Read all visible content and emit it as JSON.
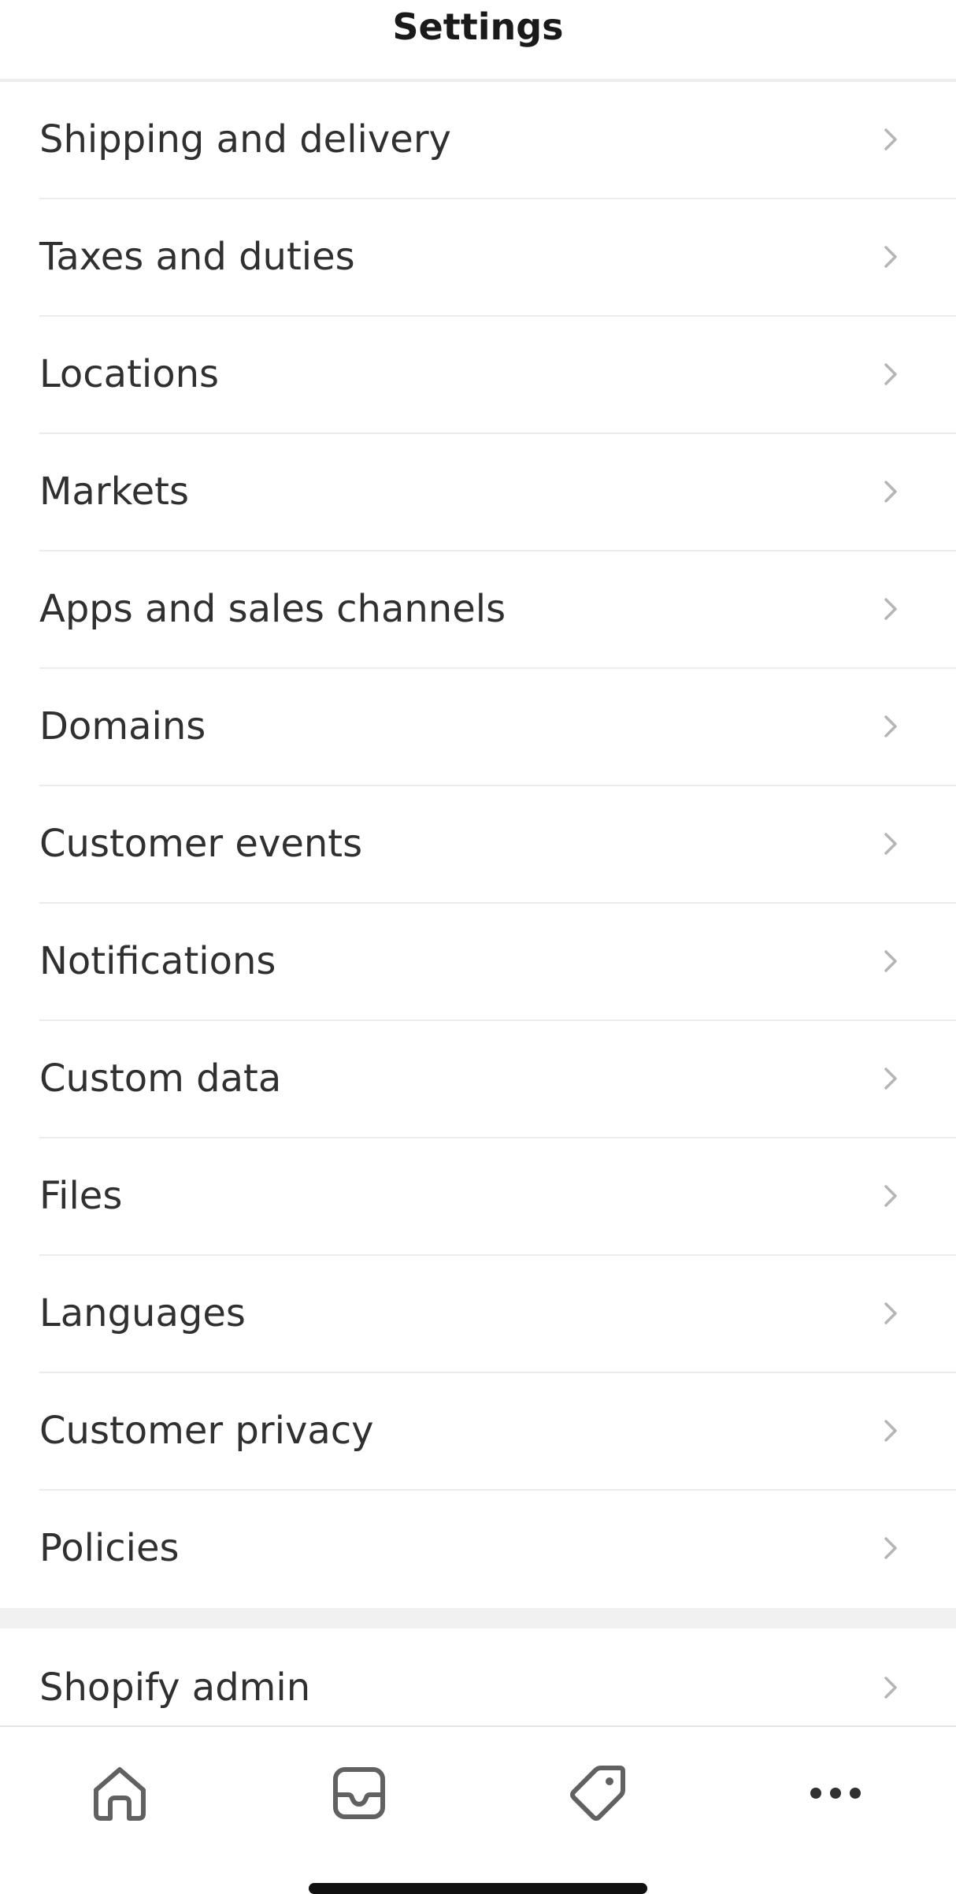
{
  "header": {
    "title": "Settings"
  },
  "settings_items": [
    {
      "label": "Shipping and delivery"
    },
    {
      "label": "Taxes and duties"
    },
    {
      "label": "Locations"
    },
    {
      "label": "Markets"
    },
    {
      "label": "Apps and sales channels"
    },
    {
      "label": "Domains"
    },
    {
      "label": "Customer events"
    },
    {
      "label": "Notifications"
    },
    {
      "label": "Custom data"
    },
    {
      "label": "Files"
    },
    {
      "label": "Languages"
    },
    {
      "label": "Customer privacy"
    },
    {
      "label": "Policies"
    }
  ],
  "secondary_items": [
    {
      "label": "Shopify admin"
    }
  ],
  "tabbar": {
    "tabs": [
      {
        "icon": "home-icon"
      },
      {
        "icon": "inbox-icon"
      },
      {
        "icon": "tag-icon"
      },
      {
        "icon": "more-icon"
      }
    ]
  },
  "colors": {
    "text": "#303030",
    "chevron": "#b5b5b5",
    "divider": "#ececec",
    "section_gap": "#f1f1f1",
    "tab_icon": "#616161"
  }
}
